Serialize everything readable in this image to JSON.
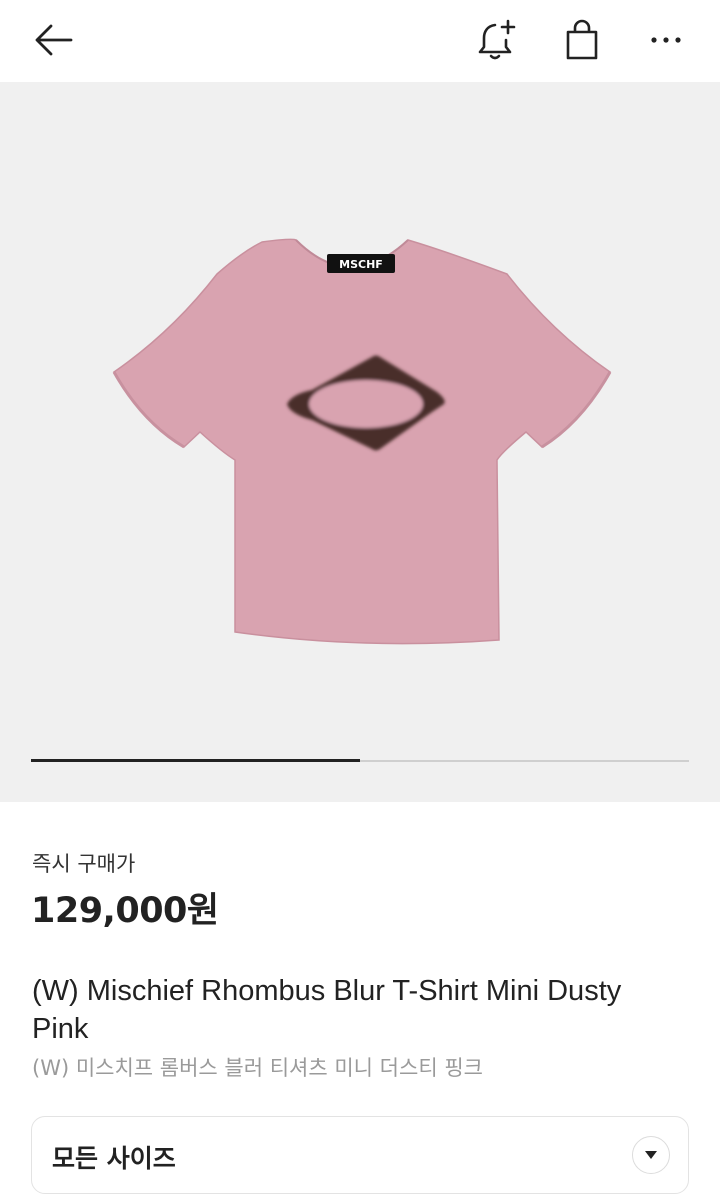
{
  "header": {
    "back_icon": "arrow-left-icon",
    "alert_icon": "bell-plus-icon",
    "bag_icon": "shopping-bag-icon",
    "more_icon": "more-horizontal-icon"
  },
  "product_image": {
    "brand_tag": "MSCHF",
    "background_color": "#f0f0f0",
    "shirt_color": "#d9a3b0",
    "carousel_progress": 0.5
  },
  "pricing": {
    "label": "즉시 구매가",
    "price": "129,000원"
  },
  "product": {
    "title_en": "(W) Mischief Rhombus Blur T-Shirt Mini Dusty Pink",
    "title_ko": "(W) 미스치프 롬버스 블러 티셔츠 미니 더스티 핑크"
  },
  "size_selector": {
    "label": "모든 사이즈",
    "icon": "chevron-down-icon"
  }
}
